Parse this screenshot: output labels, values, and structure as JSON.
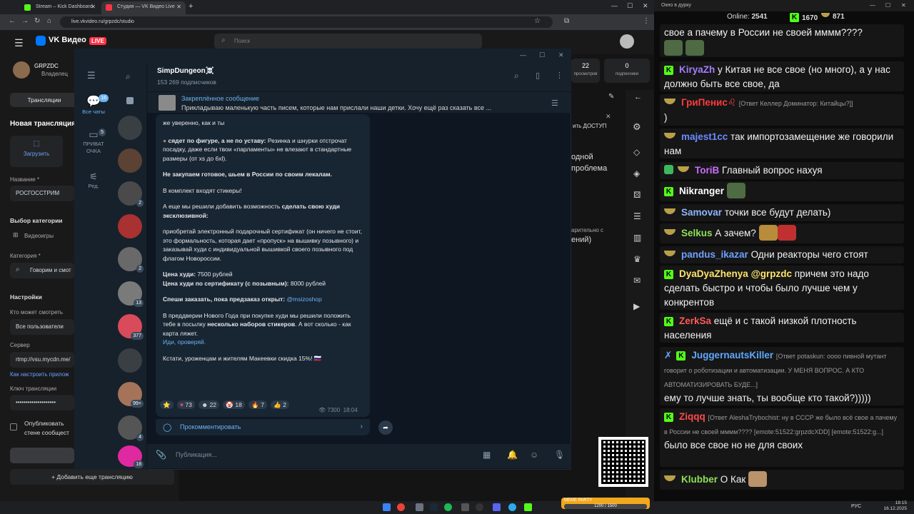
{
  "browser": {
    "tabs": [
      {
        "title": "Stream – Kick Dashboard",
        "color": "#53fc18"
      },
      {
        "title": "Студия — VK Видео Live",
        "color": "#ff3347"
      }
    ],
    "new_tab": "+",
    "url": "live.vkvideo.ru/grpzdc/studio"
  },
  "vk": {
    "brand": "VK Видео",
    "live_badge": "LIVE",
    "search_placeholder": "Поиск",
    "channel": {
      "name": "GRPZDC",
      "role": "Владелец"
    },
    "stats": [
      {
        "value": "22",
        "label": "просмотров"
      },
      {
        "value": "0",
        "label": "подписчики"
      }
    ],
    "nav_broadcasts": "Трансляции",
    "new_broadcast": "Новая трансляция",
    "upload": "Загрузить",
    "name_label": "Название *",
    "name_value": "РОСГОССТРИМ",
    "category_choice": "Выбор категории",
    "videogames": "Видеоигры",
    "category_label": "Категория *",
    "category_value": "Говорим и смот",
    "settings": "Настройки",
    "who_can_watch": "Кто может смотреть",
    "all_users": "Все пользователи",
    "server": "Сервер",
    "server_value": "rtmp://vsu.mycdn.me/",
    "howto": "Как настроить прилож",
    "key": "Ключ трансляции",
    "key_value": "••••••••••••••••••••",
    "publish": "Опубликовать",
    "publish2": "стене сообщест",
    "add_broadcast": "Добавить еще трансляцию",
    "bg_text1": "ить ДОСТУП",
    "bg_text2": "одной",
    "bg_text3": "проблема",
    "bg_text4": "арительно с",
    "bg_text5": "ений)"
  },
  "telegram": {
    "nav": [
      {
        "label": "Все чаты",
        "count": "16"
      },
      {
        "label": "ПРИВАТ ОЧКА",
        "count": "5"
      },
      {
        "label": "Ред.",
        "count": ""
      }
    ],
    "chat_badges": [
      "2",
      "2",
      "13",
      "377",
      "99+",
      "4",
      "18"
    ],
    "channel_title": "SimpDungeon☠️",
    "subscribers": "153 269 подписчиков",
    "pinned_title": "Закреплённое сообщение",
    "pinned_text": "Прикладываю маленькую часть писем, которые нам прислали наши детки.   Хочу ещё раз сказать все ...",
    "message": {
      "p0": "же уверенно, как и ты",
      "p1_bold": "сядет по фигуре, а не по уставу:",
      "p1": " Резинка и шнурки отстрочат посадку, даже если твои «парламенты» не влезают в стандартные размеры (от xs до 6xl).",
      "p2": "Не закупаем готовое, шьем в России по своим лекалам.",
      "p3": "В комплект входят стикеры!",
      "p4a": "А еще мы решили добавить возможность ",
      "p4b": "сделать свою худи эксклюзивной:",
      "p5": "приобретай электронный подарочный сертификат (он ничего не стоит, это формальность, которая дает «пропуск» на вышивку позывного) и заказывай худи с индивидуальной вышивкой своего позывного под флагом Новороссии.",
      "price1_label": "Цена худи:",
      "price1": " 7500 рублей",
      "price2_label": "Цена худи по сертификату (с позывным):",
      "price2": " 8000 рублей",
      "order": "Спеши заказать, пока предзаказ открыт: ",
      "order_link": "@msizoshop",
      "p7a": "В преддверии Нового Года при покупке худи мы решили положить тебе в посылку ",
      "p7b": "несколько наборов стикеров",
      "p7c": ". А вот сколько - как карта ляжет.",
      "p7link": "Иди, проверяй.",
      "p8": "Кстати, уроженцам и жителям Макеевки скидка 15%! 🇷🇺",
      "reactions": [
        "73",
        "22",
        "18",
        "7",
        "2"
      ],
      "views": "7300",
      "time": "18:04"
    },
    "comment": "Прокомментировать",
    "compose_placeholder": "Публикация..."
  },
  "chat": {
    "window_title": "Окно в дурку",
    "online_label": "Online:",
    "online": "2541",
    "kick_count": "1670",
    "pot_count": "871",
    "messages": [
      {
        "nick": "",
        "text": "свое а пачему в России не своей мммм????",
        "color": "#ffffff"
      },
      {
        "nick": "KiryaZh",
        "text": "у Китая не все свое (но много), а у нас должно быть все свое, да",
        "color": "#a37dff"
      },
      {
        "nick": "ГриПенис♌",
        "reply": "[Ответ Келлер Доминатор: Китайцы?]]",
        "text": ")",
        "color": "#ff3b3b"
      },
      {
        "nick": "majest1cc",
        "text": "так импортозамещение же говорили нам",
        "color": "#6a8cff"
      },
      {
        "nick": "ToriB",
        "text": "Главный вопрос нахуя",
        "color": "#c86cff"
      },
      {
        "nick": "Nikranger",
        "text": "",
        "color": "#ffffff"
      },
      {
        "nick": "Samovar",
        "text": "точки все будут делать)",
        "color": "#8fb5ff"
      },
      {
        "nick": "Selkus",
        "text": "А зачем?",
        "color": "#8ee05a"
      },
      {
        "nick": "pandus_ikazar",
        "text": "Одни реакторы чего стоят",
        "color": "#6fa2ff"
      },
      {
        "nick": "DyaDyaZhenya",
        "mention": "@grpzdc",
        "text": "причем это надо сделать быстро и чтобы было лучше чем у конкрентов",
        "color": "#ffe36b"
      },
      {
        "nick": "ZerkSa",
        "text": "ещё и с такой низкой плотность населения",
        "color": "#ff5a5a"
      },
      {
        "nick": "JuggernautsKiller",
        "reply": "[Ответ potaskun: оооо пивной мутант говорит о роботизации и автоматизации. У МЕНЯ ВОПРОС. А КТО АВТОМАТИЗИРОВАТЬ БУДЕ...]",
        "text": "ему то лучше знать, ты вообще кто такой?)))))",
        "color": "#5ea8ff"
      },
      {
        "nick": "Ziqqq",
        "reply": "[Ответ AleshaTrybochist: ну в СССР же было всё свое а пачему в России не своей мммм???? [emote:51522:grpzdcXDD] [emote:51522:g...]",
        "text": "было все свое но не для своих",
        "color": "#ff4a4a"
      },
      {
        "nick": "Klubber",
        "text": "О Как",
        "color": "#8ee05a"
      }
    ]
  },
  "taskbar": {
    "lang": "РУС",
    "time": "18:15",
    "date": "16.12.2025",
    "banner": "MEME PARTY",
    "banner_value": "1200 / 1500"
  }
}
